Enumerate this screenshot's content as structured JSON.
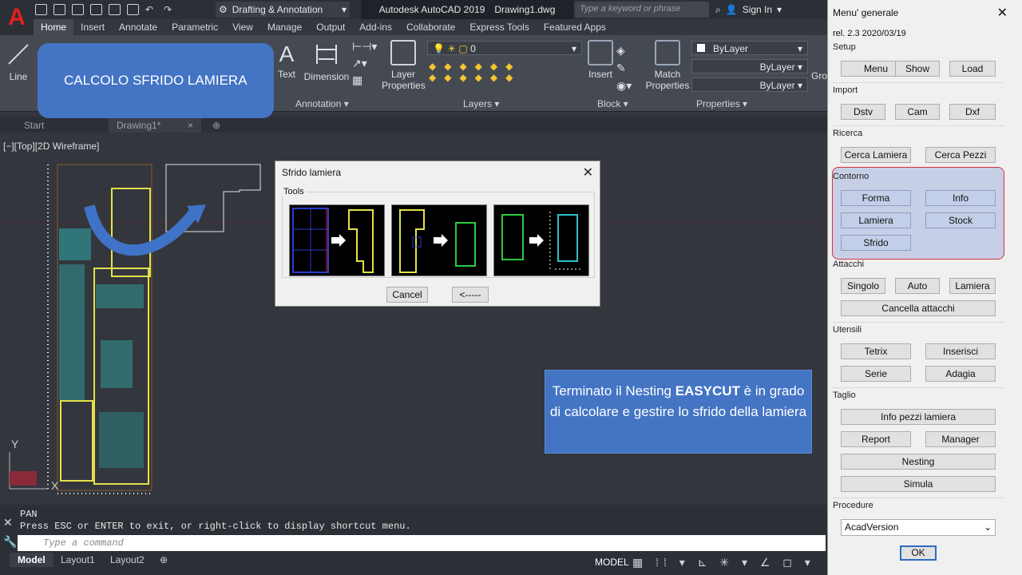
{
  "app": {
    "logo": "A",
    "title": "Autodesk AutoCAD 2019",
    "filename": "Drawing1.dwg",
    "workspace": "Drafting & Annotation",
    "search_placeholder": "Type a keyword or phrase",
    "sign_in": "Sign In"
  },
  "ribbon_tabs": [
    "Home",
    "Insert",
    "Annotate",
    "Parametric",
    "View",
    "Manage",
    "Output",
    "Add-ins",
    "Collaborate",
    "Express Tools",
    "Featured Apps"
  ],
  "ribbon": {
    "line": "Line",
    "text": "Text",
    "dimension": "Dimension",
    "annotation_panel": "Annotation",
    "layer_properties": "Layer\nProperties",
    "layer_value": "0",
    "layers_panel": "Layers",
    "insert": "Insert",
    "block_panel": "Block",
    "match_properties": "Match\nProperties",
    "properties_panel": "Properties",
    "bylayer_1": "ByLayer",
    "bylayer_2": "ByLayer",
    "bylayer_3": "ByLayer",
    "groups": "Gro"
  },
  "file_tabs": {
    "start": "Start",
    "drawing": "Drawing1*"
  },
  "view_label": "[−][Top][2D Wireframe]",
  "callout_top": "CALCOLO SFRIDO LAMIERA",
  "callout_bottom": {
    "pre": "Terminato il Nesting ",
    "bold": "EASYCUT",
    "post": " è in grado di calcolare e gestire lo sfrido della lamiera"
  },
  "dialog": {
    "title": "Sfrido lamiera",
    "group": "Tools",
    "cancel": "Cancel",
    "back": "<-----"
  },
  "command": {
    "line1": "PAN",
    "line2": "Press ESC or ENTER to exit, or right-click to display shortcut menu.",
    "placeholder": "Type a command"
  },
  "layout_tabs": [
    "Model",
    "Layout1",
    "Layout2"
  ],
  "status": {
    "model": "MODEL"
  },
  "menu": {
    "title": "Menu' generale",
    "version": "rel. 2.3 2020/03/19",
    "setup": {
      "label": "Setup",
      "buttons": [
        "Menu",
        "Show",
        "Load"
      ]
    },
    "import": {
      "label": "Import",
      "buttons": [
        "Dstv",
        "Cam",
        "Dxf"
      ]
    },
    "ricerca": {
      "label": "Ricerca",
      "buttons": [
        "Cerca Lamiera",
        "Cerca Pezzi"
      ]
    },
    "contorno": {
      "label": "Contorno",
      "buttons": [
        "Forma",
        "Info",
        "Lamiera",
        "Stock",
        "Sfrido"
      ]
    },
    "attacchi": {
      "label": "Attacchi",
      "buttons": [
        "Singolo",
        "Auto",
        "Lamiera",
        "Cancella attacchi"
      ]
    },
    "utensili": {
      "label": "Utensili",
      "buttons": [
        "Tetrix",
        "Inserisci",
        "Serie",
        "Adagia"
      ]
    },
    "taglio": {
      "label": "Taglio",
      "buttons": [
        "Info pezzi lamiera",
        "Report",
        "Manager",
        "Nesting",
        "Simula"
      ]
    },
    "procedure": {
      "label": "Procedure",
      "selected": "AcadVersion"
    },
    "ok": "OK"
  }
}
